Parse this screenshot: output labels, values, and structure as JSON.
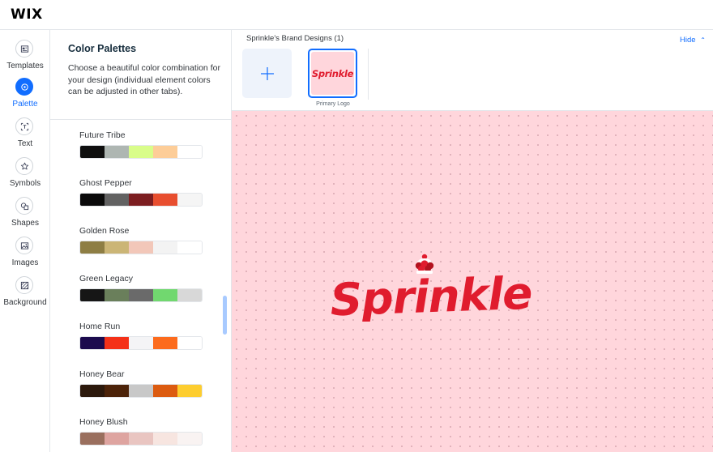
{
  "app": {
    "logo": "WIX"
  },
  "rail": {
    "items": [
      {
        "label": "Templates",
        "icon": "templates-icon",
        "active": false
      },
      {
        "label": "Palette",
        "icon": "palette-icon",
        "active": true
      },
      {
        "label": "Text",
        "icon": "text-icon",
        "active": false
      },
      {
        "label": "Symbols",
        "icon": "star-icon",
        "active": false
      },
      {
        "label": "Shapes",
        "icon": "shapes-icon",
        "active": false
      },
      {
        "label": "Images",
        "icon": "image-icon",
        "active": false
      },
      {
        "label": "Background",
        "icon": "background-icon",
        "active": false
      }
    ]
  },
  "panel": {
    "title": "Color Palettes",
    "description": "Choose a beautiful color combination for your design (individual element colors can be adjusted in other tabs).",
    "palettes": [
      {
        "name": "Future Tribe",
        "colors": [
          "#0f0f0f",
          "#aeb6b2",
          "#d9fd8a",
          "#fdcd98",
          "#ffffff"
        ]
      },
      {
        "name": "Ghost Pepper",
        "colors": [
          "#0a0a0a",
          "#626262",
          "#7c1d20",
          "#e84e2f",
          "#f5f5f5"
        ]
      },
      {
        "name": "Golden Rose",
        "colors": [
          "#8e7e44",
          "#cbb576",
          "#f2c7b9",
          "#f3f3f3",
          "#ffffff"
        ]
      },
      {
        "name": "Green Legacy",
        "colors": [
          "#161616",
          "#6a7f5b",
          "#6a6a6a",
          "#71d86f",
          "#d8d8d8"
        ]
      },
      {
        "name": "Home Run",
        "colors": [
          "#1c0b4e",
          "#f43118",
          "#f4f4f6",
          "#fc6b1d",
          "#ffffff"
        ]
      },
      {
        "name": "Honey Bear",
        "colors": [
          "#2c190c",
          "#4c2309",
          "#c8c8c8",
          "#dc5b10",
          "#fdcd2f"
        ]
      },
      {
        "name": "Honey Blush",
        "colors": [
          "#9a6f5e",
          "#dea4a0",
          "#e9c5c1",
          "#f7e5e0",
          "#f9f3f2"
        ]
      }
    ]
  },
  "designs": {
    "title": "Sprinkle's Brand Designs (1)",
    "hide_label": "Hide",
    "tile_caption": "Primary Logo"
  },
  "brand": {
    "name": "Sprinkle",
    "primary_color": "#e01c2e",
    "canvas_color": "#ffd6dc",
    "accent": "#116dff"
  }
}
